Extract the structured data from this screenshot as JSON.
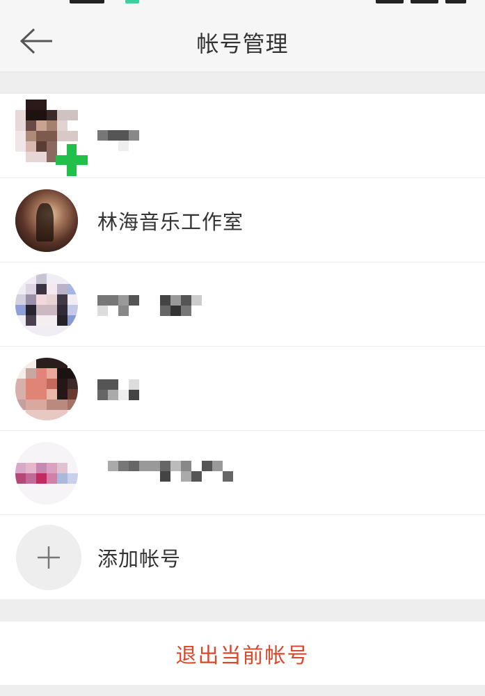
{
  "header": {
    "title": "帐号管理"
  },
  "accounts": [
    {
      "name": "",
      "current": true
    },
    {
      "name": "林海音乐工作室",
      "current": false
    },
    {
      "name": "",
      "current": false
    },
    {
      "name": "",
      "current": false
    },
    {
      "name": "",
      "current": false
    }
  ],
  "add_account": {
    "label": "添加帐号"
  },
  "logout": {
    "label": "退出当前帐号"
  },
  "colors": {
    "accent_green": "#22c04a",
    "logout_red": "#d9482a",
    "background": "#eeeeee"
  },
  "icons": {
    "back": "arrow-left-icon",
    "add": "plus-icon",
    "current_badge": "plus-icon"
  }
}
